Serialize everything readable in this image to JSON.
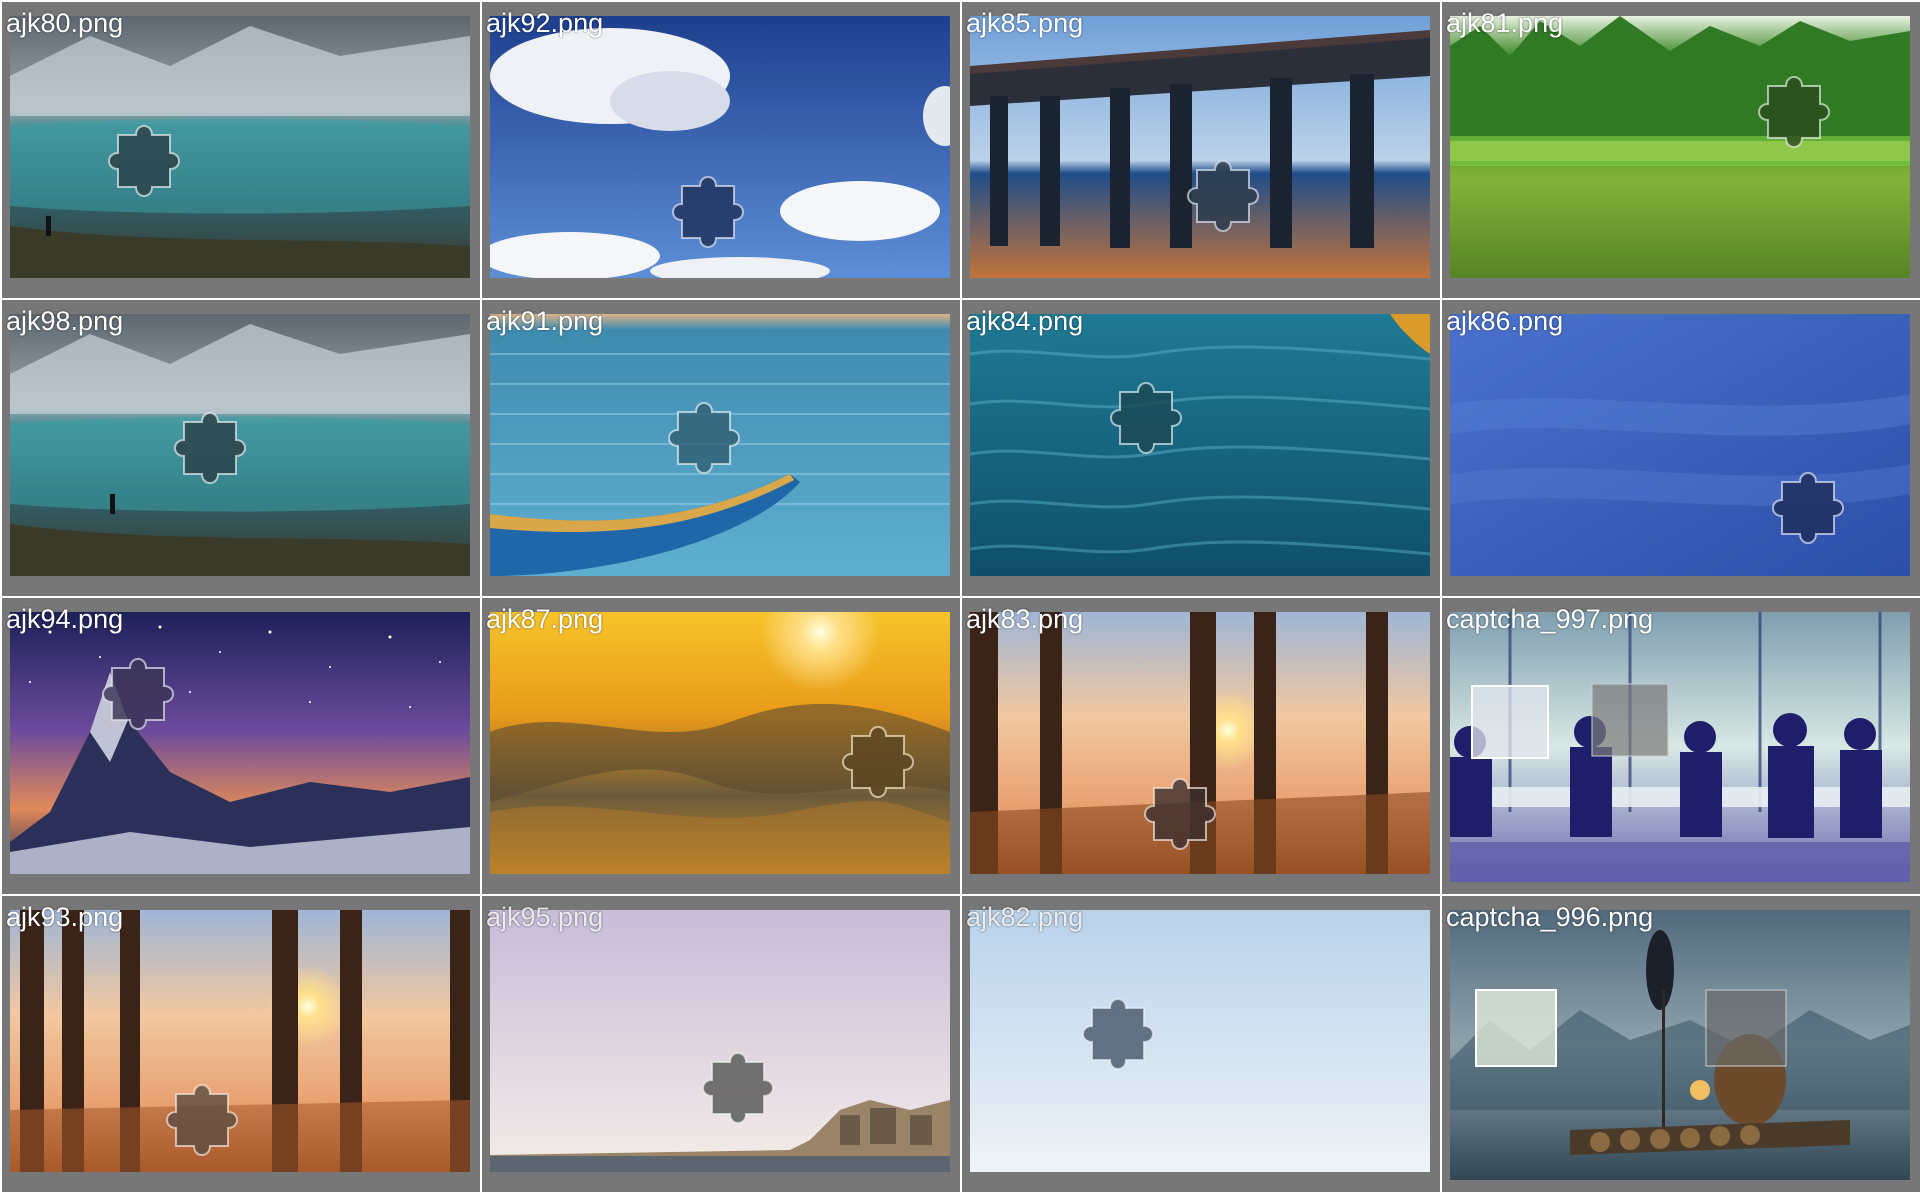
{
  "gallery": {
    "tiles": [
      {
        "filename": "ajk80.png",
        "scene": "mountain-lake",
        "icon": "puzzle-piece-icon"
      },
      {
        "filename": "ajk92.png",
        "scene": "blue-sky-clouds",
        "icon": "puzzle-piece-icon"
      },
      {
        "filename": "ajk85.png",
        "scene": "ocean-pier",
        "icon": "puzzle-piece-icon"
      },
      {
        "filename": "ajk81.png",
        "scene": "green-forest-lake",
        "icon": "puzzle-piece-icon"
      },
      {
        "filename": "ajk98.png",
        "scene": "mountain-lake",
        "icon": "puzzle-piece-icon"
      },
      {
        "filename": "ajk91.png",
        "scene": "sea-boat",
        "icon": "puzzle-piece-icon"
      },
      {
        "filename": "ajk84.png",
        "scene": "sea-waves",
        "icon": "puzzle-piece-icon"
      },
      {
        "filename": "ajk86.png",
        "scene": "blue-sky",
        "icon": "puzzle-piece-icon"
      },
      {
        "filename": "ajk94.png",
        "scene": "starry-mountain",
        "icon": "puzzle-piece-icon"
      },
      {
        "filename": "ajk87.png",
        "scene": "golden-clouds",
        "icon": "puzzle-piece-icon"
      },
      {
        "filename": "ajk83.png",
        "scene": "sunset-forest",
        "icon": "puzzle-piece-icon"
      },
      {
        "filename": "captcha_997.png",
        "scene": "office-silhouettes",
        "icon": "puzzle-piece-icon"
      },
      {
        "filename": "ajk93.png",
        "scene": "sunset-forest",
        "icon": "puzzle-piece-icon"
      },
      {
        "filename": "ajk95.png",
        "scene": "pale-sky-town",
        "icon": "puzzle-piece-icon"
      },
      {
        "filename": "ajk82.png",
        "scene": "pale-blue-sky",
        "icon": "puzzle-piece-icon"
      },
      {
        "filename": "captcha_996.png",
        "scene": "fisherman-cormorants",
        "icon": "puzzle-piece-icon"
      }
    ]
  },
  "colors": {
    "tile_background": "#777777",
    "grid_gap": "#ffffff",
    "label_text": "#ffffff"
  }
}
